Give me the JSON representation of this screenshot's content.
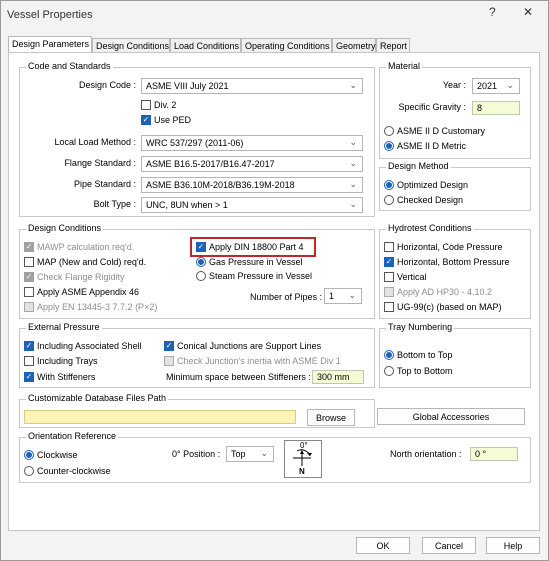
{
  "window": {
    "title": "Vessel Properties",
    "help_glyph": "?",
    "close_glyph": "✕"
  },
  "tabs": [
    "Design Parameters",
    "Design Conditions",
    "Load Conditions",
    "Operating Conditions",
    "Geometry",
    "Report"
  ],
  "code": {
    "group": "Code and Standards",
    "design_code_label": "Design Code :",
    "design_code": "ASME VIII July 2021",
    "div2": "Div. 2",
    "use_ped": "Use PED",
    "local_load_label": "Local Load Method :",
    "local_load": "WRC 537/297 (2011-06)",
    "flange_label": "Flange Standard :",
    "flange": "ASME B16.5-2017/B16.47-2017",
    "pipe_label": "Pipe Standard :",
    "pipe": "ASME B36.10M-2018/B36.19M-2018",
    "bolt_label": "Bolt Type :",
    "bolt": "UNC, 8UN when > 1"
  },
  "material": {
    "group": "Material",
    "year_label": "Year :",
    "year": "2021",
    "sg_label": "Specific Gravity :",
    "sg": "8",
    "customary": "ASME II D Customary",
    "metric": "ASME II D Metric"
  },
  "method": {
    "group": "Design Method",
    "optimized": "Optimized Design",
    "checked": "Checked Design"
  },
  "conditions": {
    "group": "Design Conditions",
    "mawp": "MAWP calculation req'd.",
    "map": "MAP (New and Cold) req'd.",
    "flange_rigidity": "Check Flange Rigidity",
    "appendix46": "Apply ASME Appendix 46",
    "en13445": "Apply EN 13445-3 7.7.2 (P×2)",
    "din": "Apply DIN 18800 Part 4",
    "gas": "Gas Pressure in Vessel",
    "steam": "Steam Pressure in Vessel",
    "pipes_label": "Number of Pipes :",
    "pipes": "1"
  },
  "hydrotest": {
    "group": "Hydrotest Conditions",
    "h_code": "Horizontal, Code Pressure",
    "h_bottom": "Horizontal, Bottom Pressure",
    "vertical": "Vertical",
    "ad_hp30": "Apply AD HP30 - 4.10.2",
    "ug99": "UG-99(c) (based on MAP)"
  },
  "external": {
    "group": "External Pressure",
    "shell": "Including Associated Shell",
    "trays": "Including Trays",
    "stiffeners": "With Stiffeners",
    "conical": "Conical Junctions are Support Lines",
    "inertia": "Check Junction's inertia with ASME Div 1",
    "min_space_label": "Minimum space between Stiffeners :",
    "min_space": "300 mm"
  },
  "tray": {
    "group": "Tray Numbering",
    "b2t": "Bottom to Top",
    "t2b": "Top to Bottom"
  },
  "db": {
    "group": "Customizable Database Files Path",
    "path": "",
    "browse": "Browse"
  },
  "global_accessories": "Global Accessories",
  "orientation": {
    "group": "Orientation Reference",
    "clockwise": "Clockwise",
    "ccw": "Counter-clockwise",
    "pos_label": "0° Position :",
    "pos": "Top",
    "diagram_top": "0°",
    "diagram_n": "N",
    "north_label": "North orientation :",
    "north": "0 °"
  },
  "buttons": {
    "ok": "OK",
    "cancel": "Cancel",
    "help": "Help"
  }
}
